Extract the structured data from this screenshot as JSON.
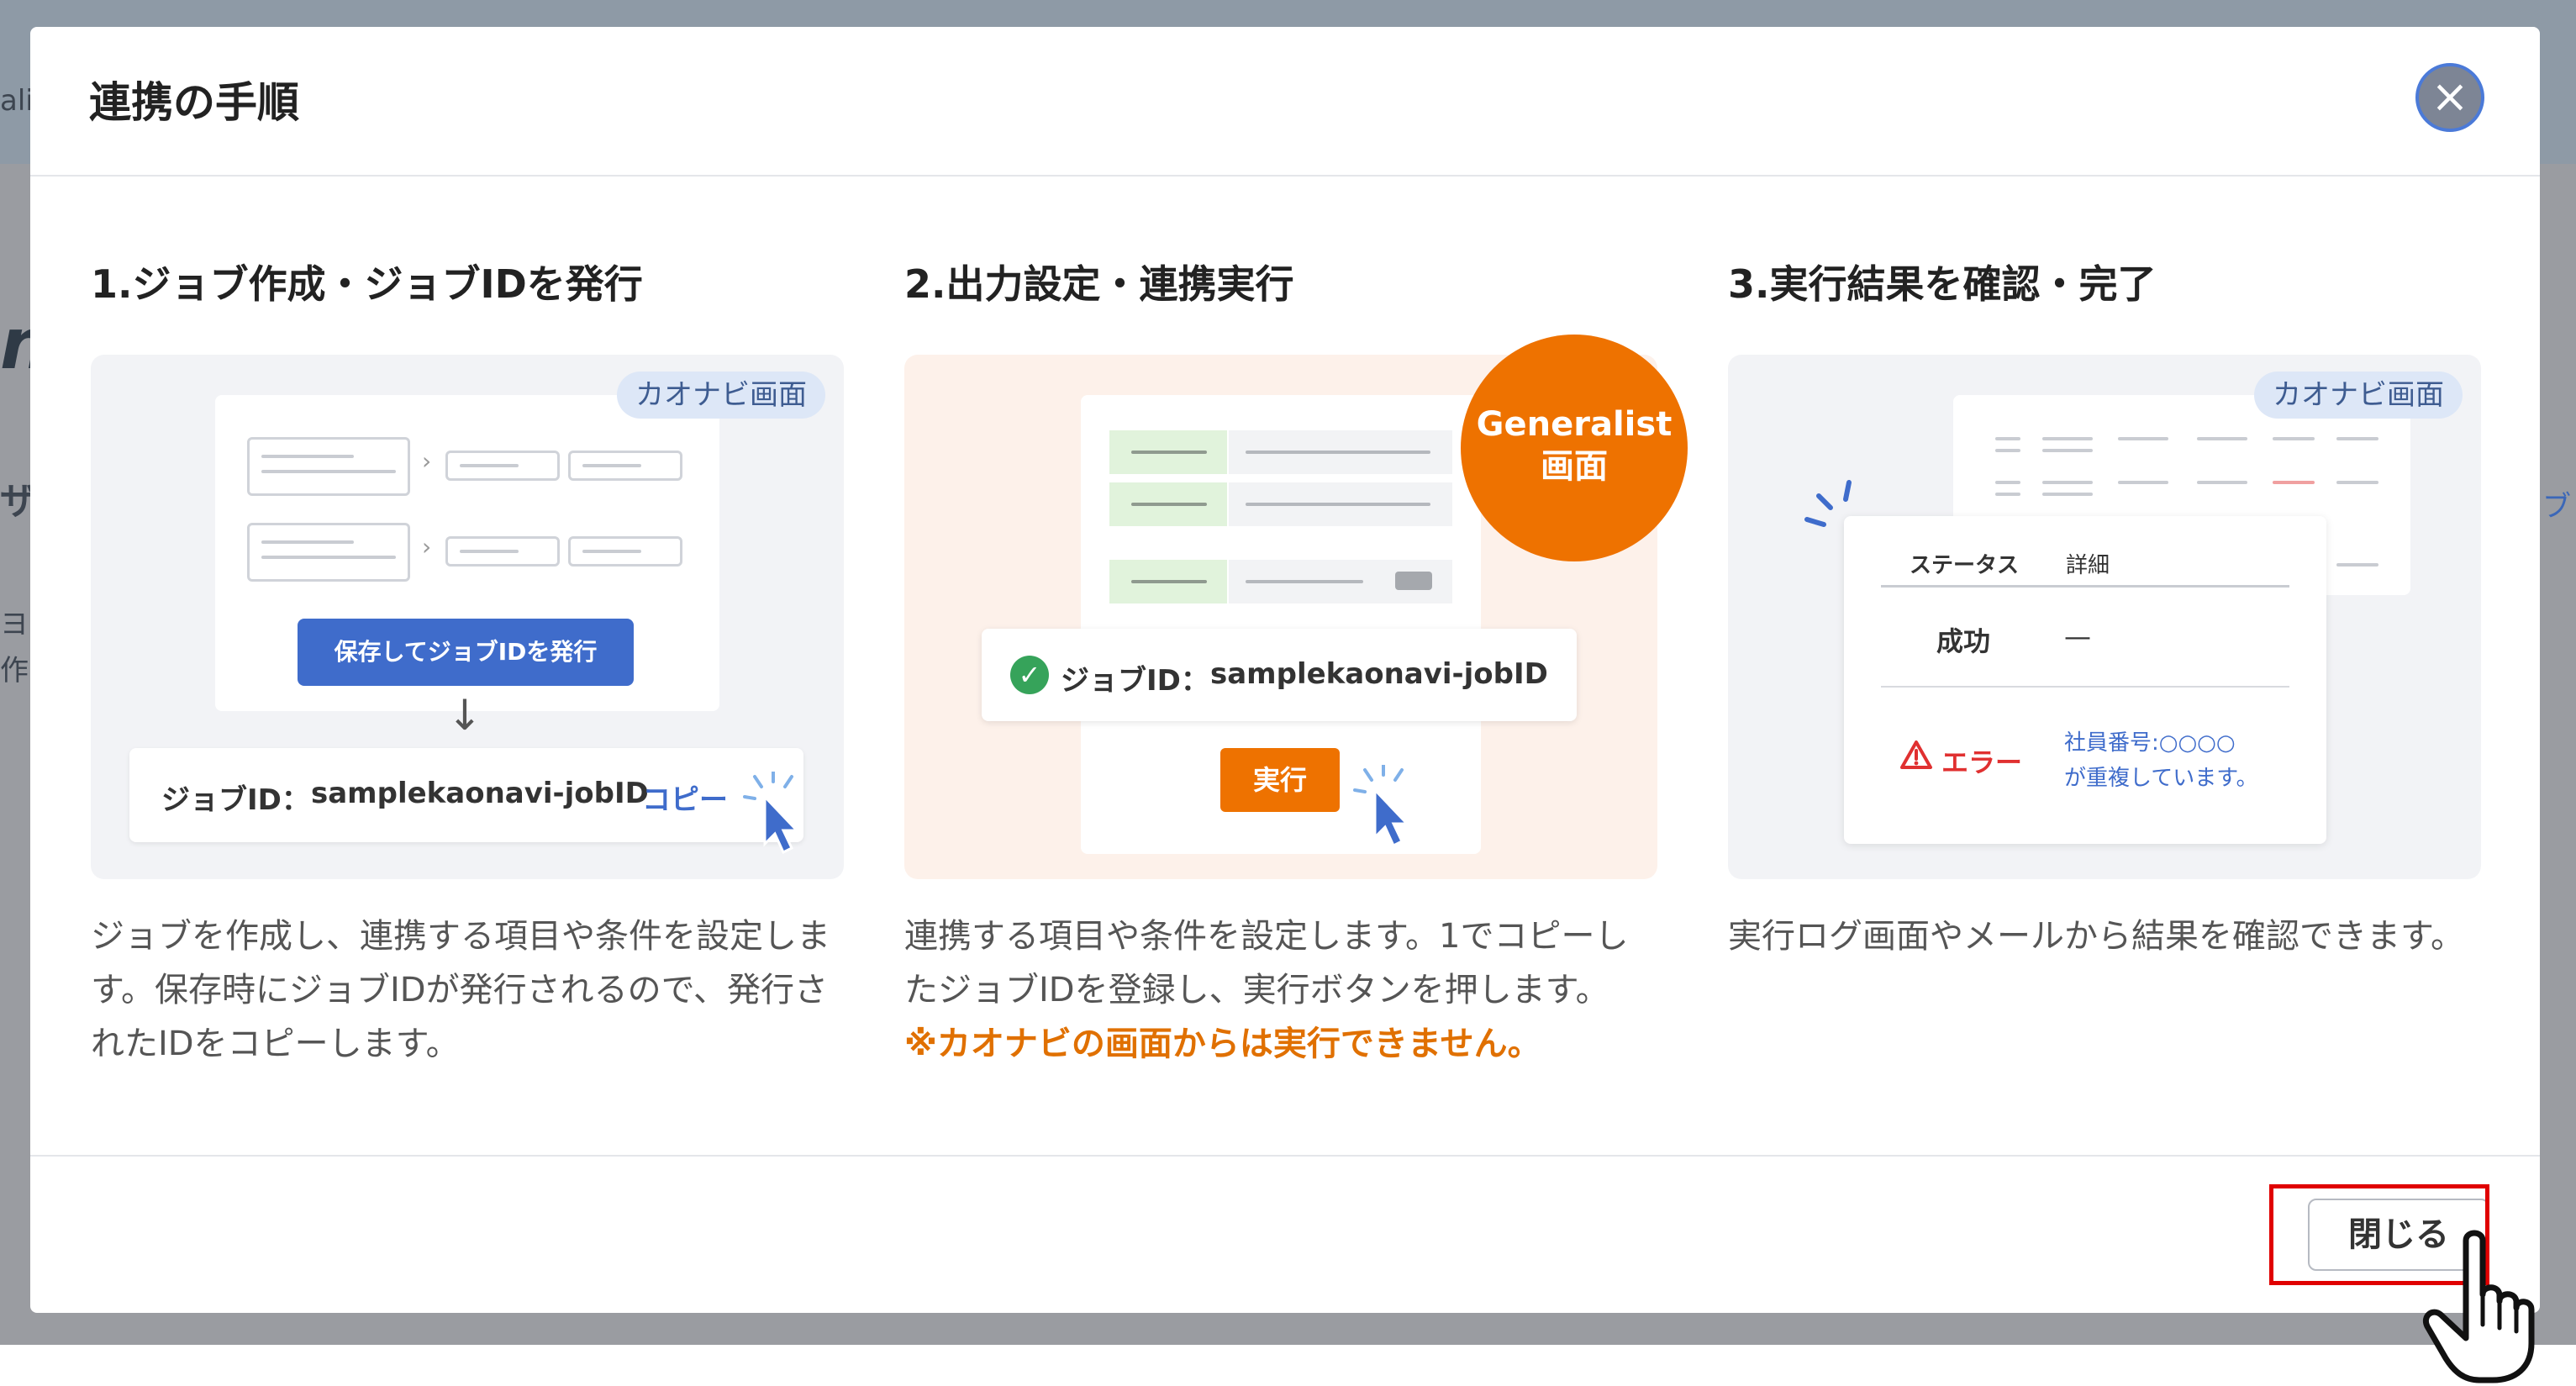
{
  "background": {
    "fragments": [
      "alis",
      "n",
      "ザ",
      "ヨ",
      "作",
      "ブ"
    ]
  },
  "modal": {
    "title": "連携の手順",
    "close_icon": "close-icon",
    "close_label": "閉じる"
  },
  "steps": [
    {
      "title": "1.ジョブ作成・ジョブIDを発行",
      "tag": "カオナビ画面",
      "button": "保存してジョブIDを発行",
      "arrow": "↓",
      "job_id_label": "ジョブID：",
      "job_id_value": "samplekaonavi-jobID",
      "copy": "コピー",
      "description": "ジョブを作成し、連携する項目や条件を設定します。保存時にジョブIDが発行されるので、発行されたIDをコピーします。"
    },
    {
      "title": "2.出力設定・連携実行",
      "badge_line1": "Generalist",
      "badge_line2": "画面",
      "job_id_label": "ジョブID：",
      "job_id_value": "samplekaonavi-jobID",
      "execute": "実行",
      "description": "連携する項目や条件を設定します。1でコピーしたジョブIDを登録し、実行ボタンを押します。",
      "warning": "※カオナビの画面からは実行できません。"
    },
    {
      "title": "3.実行結果を確認・完了",
      "tag": "カオナビ画面",
      "col_status": "ステータス",
      "col_detail": "詳細",
      "success": "成功",
      "success_detail": "—",
      "error": "エラー",
      "error_msg_line1": "社員番号:○○○○",
      "error_msg_line2": "が重複しています。",
      "description": "実行ログ画面やメールから結果を確認できます。"
    }
  ],
  "colors": {
    "accent_blue": "#3f6ccb",
    "accent_orange": "#ee7200",
    "error_red": "#e03030",
    "highlight": "#e00000"
  }
}
